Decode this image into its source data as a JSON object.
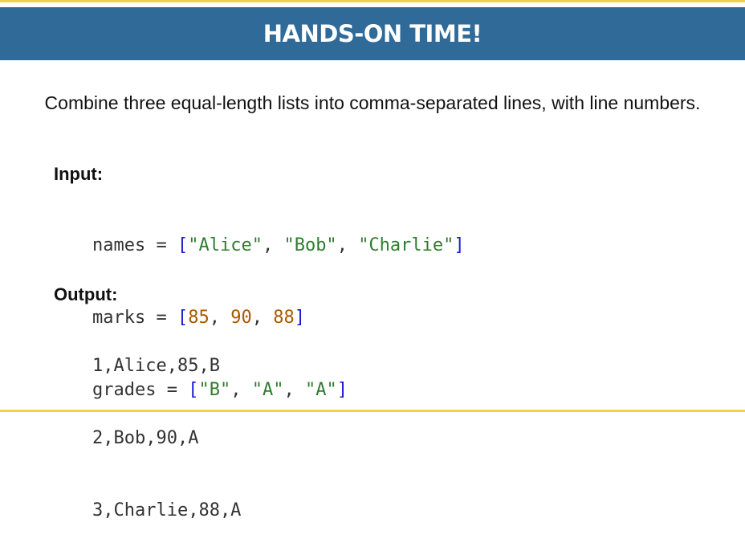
{
  "header": {
    "title": "HANDS-ON TIME!"
  },
  "intro_text": "Combine three equal-length lists into comma-separated lines, with line numbers.",
  "input": {
    "label": "Input:",
    "names": {
      "var": "names",
      "op": " = ",
      "values": [
        "\"Alice\"",
        "\"Bob\"",
        "\"Charlie\""
      ]
    },
    "marks": {
      "var": "marks",
      "op": " = ",
      "values": [
        "85",
        "90",
        "88"
      ]
    },
    "grades": {
      "var": "grades",
      "op": " = ",
      "values": [
        "\"B\"",
        "\"A\"",
        "\"A\""
      ]
    },
    "open_bracket": "[",
    "close_bracket": "]",
    "separator": ", "
  },
  "output": {
    "label": "Output:",
    "lines": [
      "1,Alice,85,B",
      "2,Bob,90,A",
      "3,Charlie,88,A"
    ]
  },
  "colors": {
    "header_bg": "#2f6a98",
    "accent_stripe": "#f2d04a",
    "bracket": "#1a1ad0",
    "string": "#2e7d2e",
    "number": "#a85a00"
  }
}
